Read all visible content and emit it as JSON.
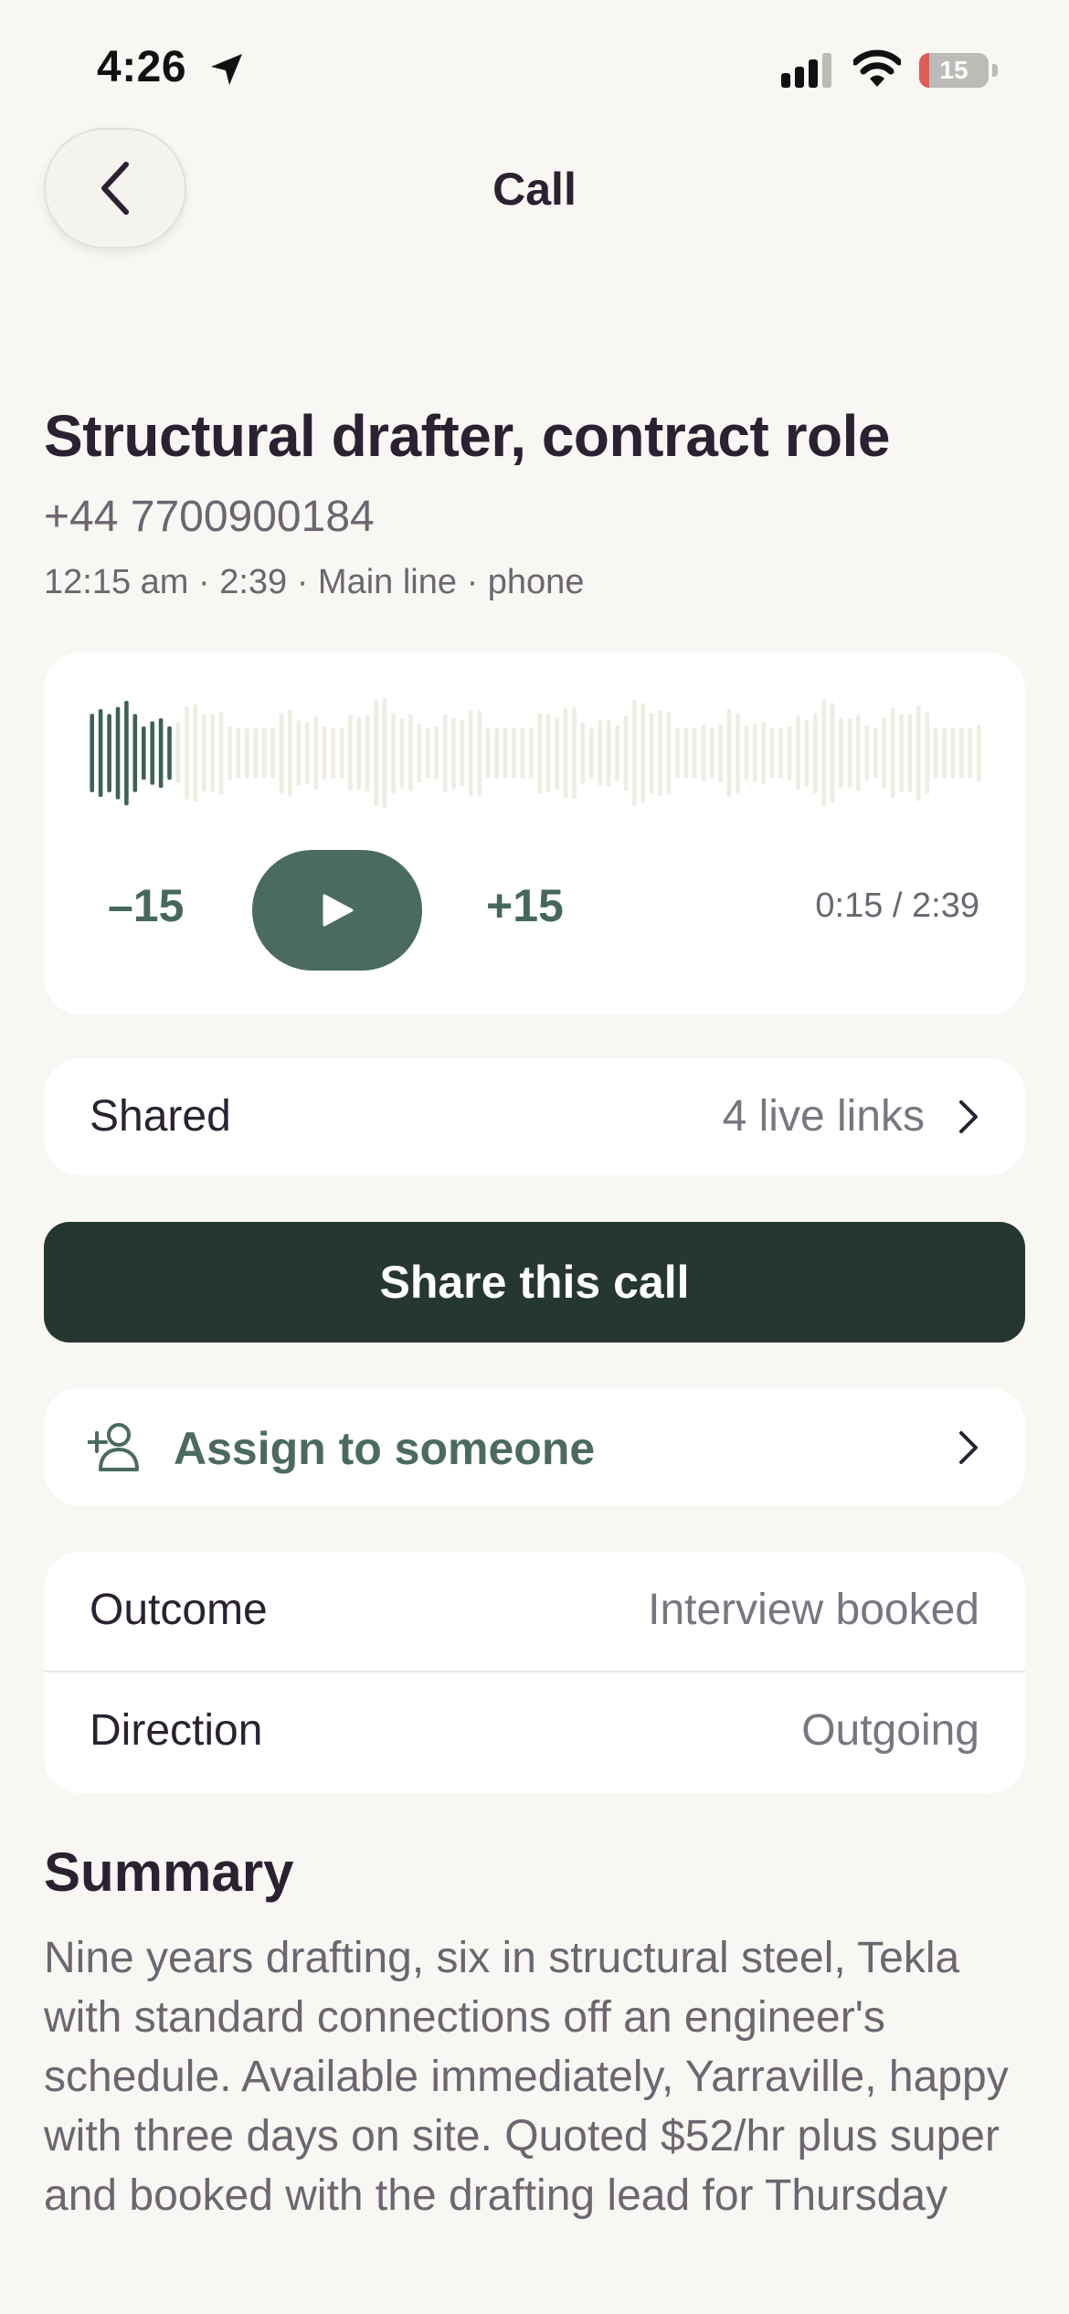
{
  "status": {
    "time": "4:26",
    "battery": "15",
    "battery_level": 0.15,
    "battery_color": "#e25b57"
  },
  "nav": {
    "title": "Call",
    "back_icon": "chevron-left-icon"
  },
  "call": {
    "title": "Structural drafter, contract role",
    "number": "+44 7700900184",
    "meta": "12:15 am · 2:39 · Main line · phone"
  },
  "player": {
    "skip_back": "–15",
    "skip_forward": "+15",
    "time": "0:15 / 2:39",
    "progress": 0.094,
    "played_color": "#3f6152",
    "unplayed_color": "#efece3",
    "accent": "#4a6b5d"
  },
  "shared": {
    "label": "Shared",
    "value": "4 live links"
  },
  "share_button": {
    "label": "Share this call",
    "color": "#263731"
  },
  "assign": {
    "label": "Assign to someone",
    "icon": "add-person-icon"
  },
  "details": {
    "outcome_label": "Outcome",
    "outcome_value": "Interview booked",
    "direction_label": "Direction",
    "direction_value": "Outgoing"
  },
  "summary": {
    "title": "Summary",
    "body": "Nine years drafting, six in structural steel, Tekla with standard connections off an engineer's schedule. Available immediately, Yarraville, happy with three days on site. Quoted $52/hr plus super and booked with the drafting lead for Thursday"
  }
}
